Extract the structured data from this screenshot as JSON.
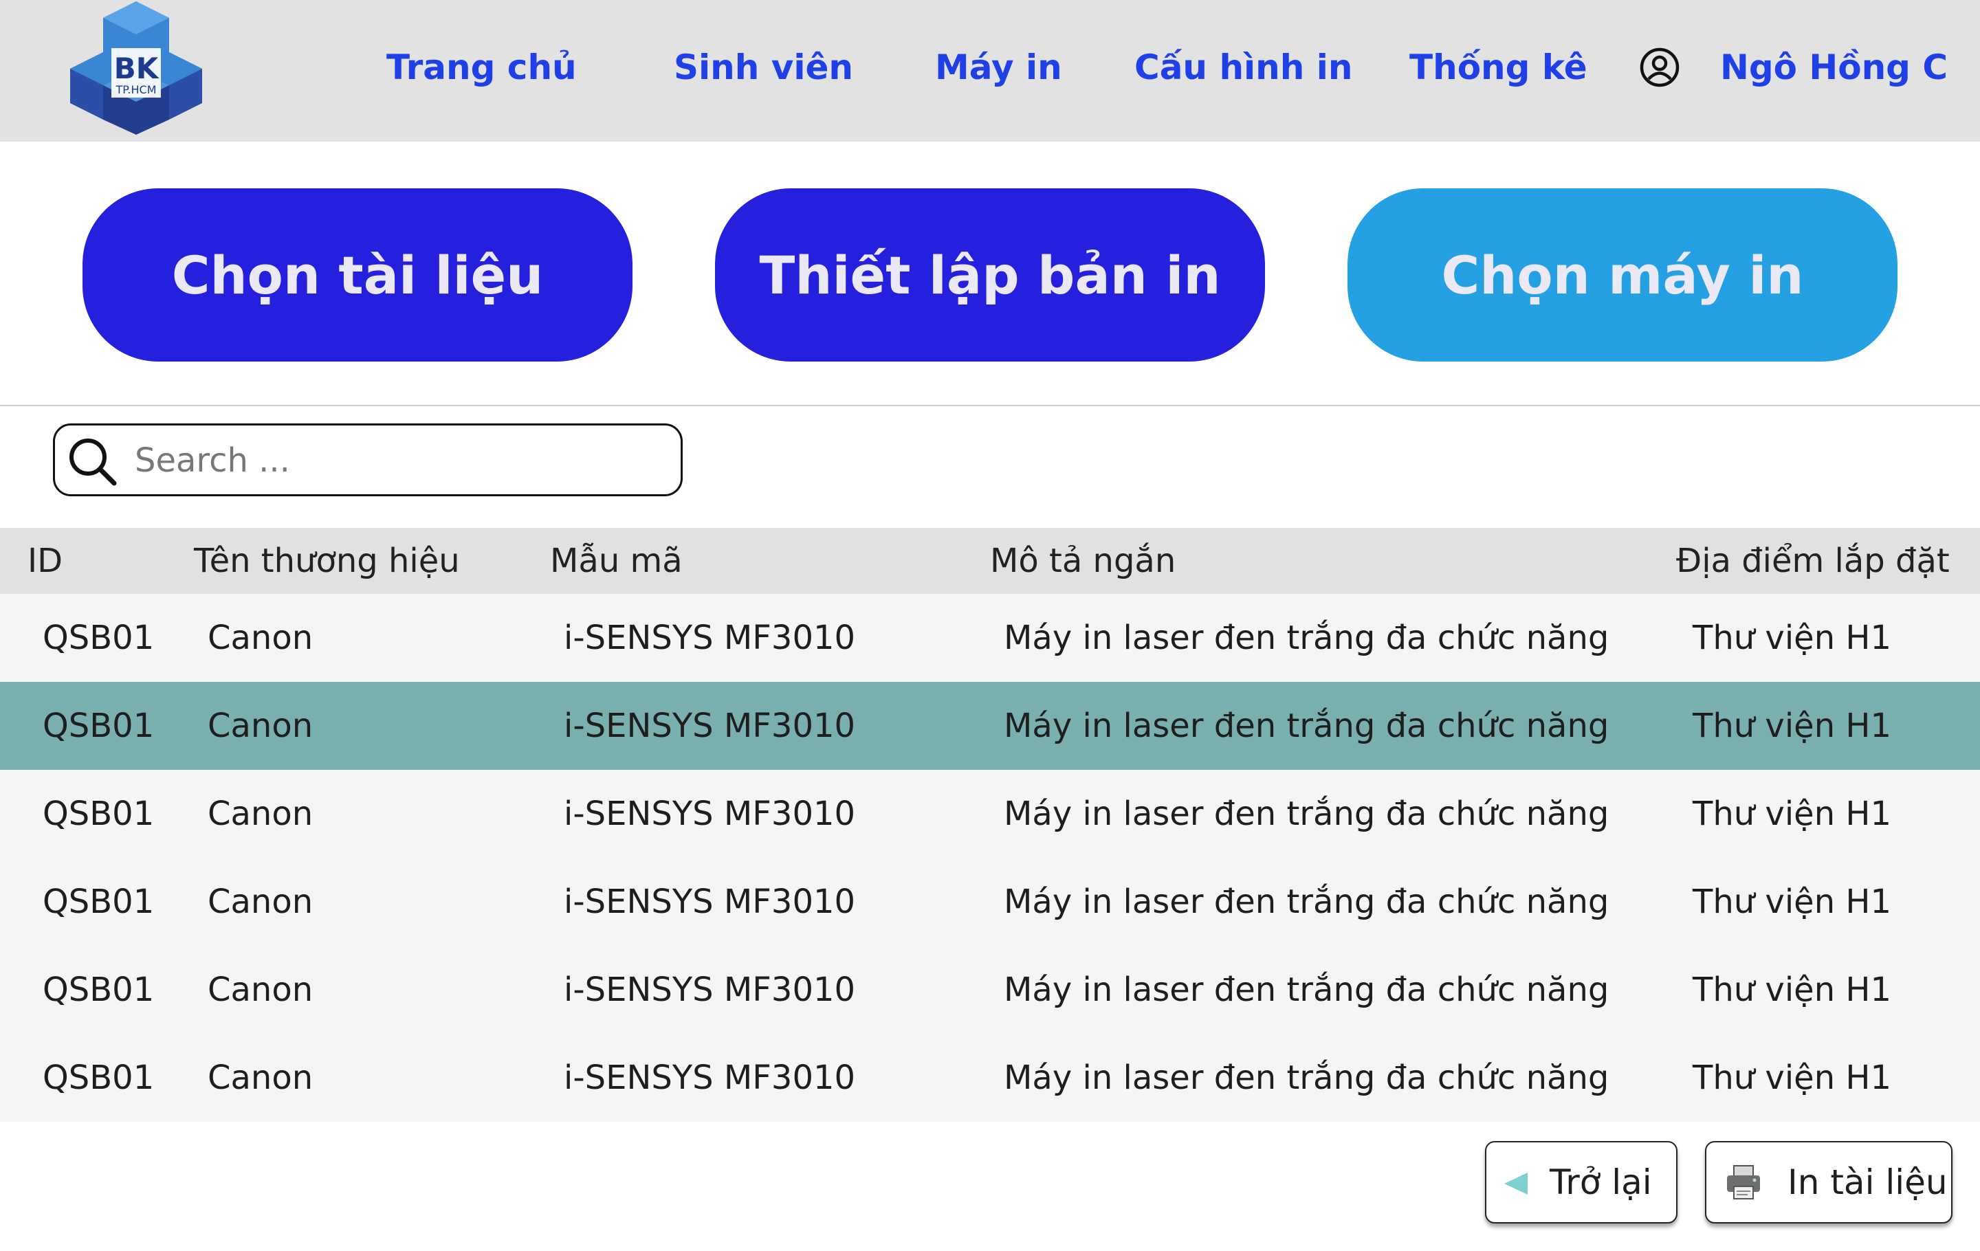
{
  "logo": {
    "text": "BK",
    "subtext": "TP.HCM"
  },
  "nav": {
    "items": [
      {
        "label": "Trang chủ"
      },
      {
        "label": "Sinh viên"
      },
      {
        "label": "Máy in"
      },
      {
        "label": "Cấu hình in"
      },
      {
        "label": "Thống kê"
      }
    ],
    "user_icon": "user-circle-icon",
    "user_name": "Ngô Hồng C"
  },
  "steps": [
    {
      "label": "Chọn tài liệu",
      "active": false
    },
    {
      "label": "Thiết lập bản in",
      "active": false
    },
    {
      "label": "Chọn máy in",
      "active": true
    }
  ],
  "search": {
    "icon": "search-icon",
    "placeholder": "Search ...",
    "value": ""
  },
  "table": {
    "headers": [
      "ID",
      "Tên thương hiệu",
      "Mẫu mã",
      "Mô tả ngắn",
      "Địa điểm lắp đặt"
    ],
    "rows": [
      {
        "cells": [
          "QSB01",
          "Canon",
          "i-SENSYS MF3010",
          "Máy in laser đen trắng đa chức năng",
          "Thư viện H1"
        ],
        "selected": false
      },
      {
        "cells": [
          "QSB01",
          "Canon",
          "i-SENSYS MF3010",
          "Máy in laser đen trắng đa chức năng",
          "Thư viện H1"
        ],
        "selected": true
      },
      {
        "cells": [
          "QSB01",
          "Canon",
          "i-SENSYS MF3010",
          "Máy in laser đen trắng đa chức năng",
          "Thư viện H1"
        ],
        "selected": false
      },
      {
        "cells": [
          "QSB01",
          "Canon",
          "i-SENSYS MF3010",
          "Máy in laser đen trắng đa chức năng",
          "Thư viện H1"
        ],
        "selected": false
      },
      {
        "cells": [
          "QSB01",
          "Canon",
          "i-SENSYS MF3010",
          "Máy in laser đen trắng đa chức năng",
          "Thư viện H1"
        ],
        "selected": false
      },
      {
        "cells": [
          "QSB01",
          "Canon",
          "i-SENSYS MF3010",
          "Máy in laser đen trắng đa chức năng",
          "Thư viện H1"
        ],
        "selected": false
      }
    ]
  },
  "actions": {
    "back": {
      "label": "Trở lại",
      "icon": "triangle-left-icon"
    },
    "print": {
      "label": "In tài liệu",
      "icon": "printer-icon"
    }
  },
  "colors": {
    "nav_text": "#1f40e6",
    "step_dark": "#2520de",
    "step_active": "#25a0e2",
    "selected_row": "#7aafb0",
    "header_bg": "#e2e2e2"
  }
}
